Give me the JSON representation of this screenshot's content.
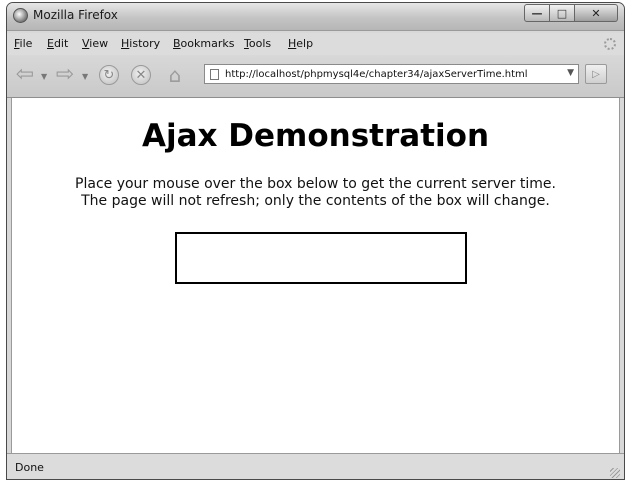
{
  "window": {
    "title": "Mozilla Firefox"
  },
  "menu": {
    "items": [
      "File",
      "Edit",
      "View",
      "History",
      "Bookmarks",
      "Tools",
      "Help"
    ]
  },
  "navigation": {
    "url": "http://localhost/phpmysql4e/chapter34/ajaxServerTime.html",
    "icons": [
      "back-icon",
      "forward-icon",
      "reload-icon",
      "stop-icon",
      "home-icon",
      "page-icon",
      "go-icon"
    ]
  },
  "page": {
    "heading": "Ajax Demonstration",
    "instruction_line1": "Place your mouse over the box below to get the current server time.",
    "instruction_line2": "The page will not refresh; only the contents of the box will change.",
    "time_box_text": ""
  },
  "status": {
    "text": "Done"
  }
}
